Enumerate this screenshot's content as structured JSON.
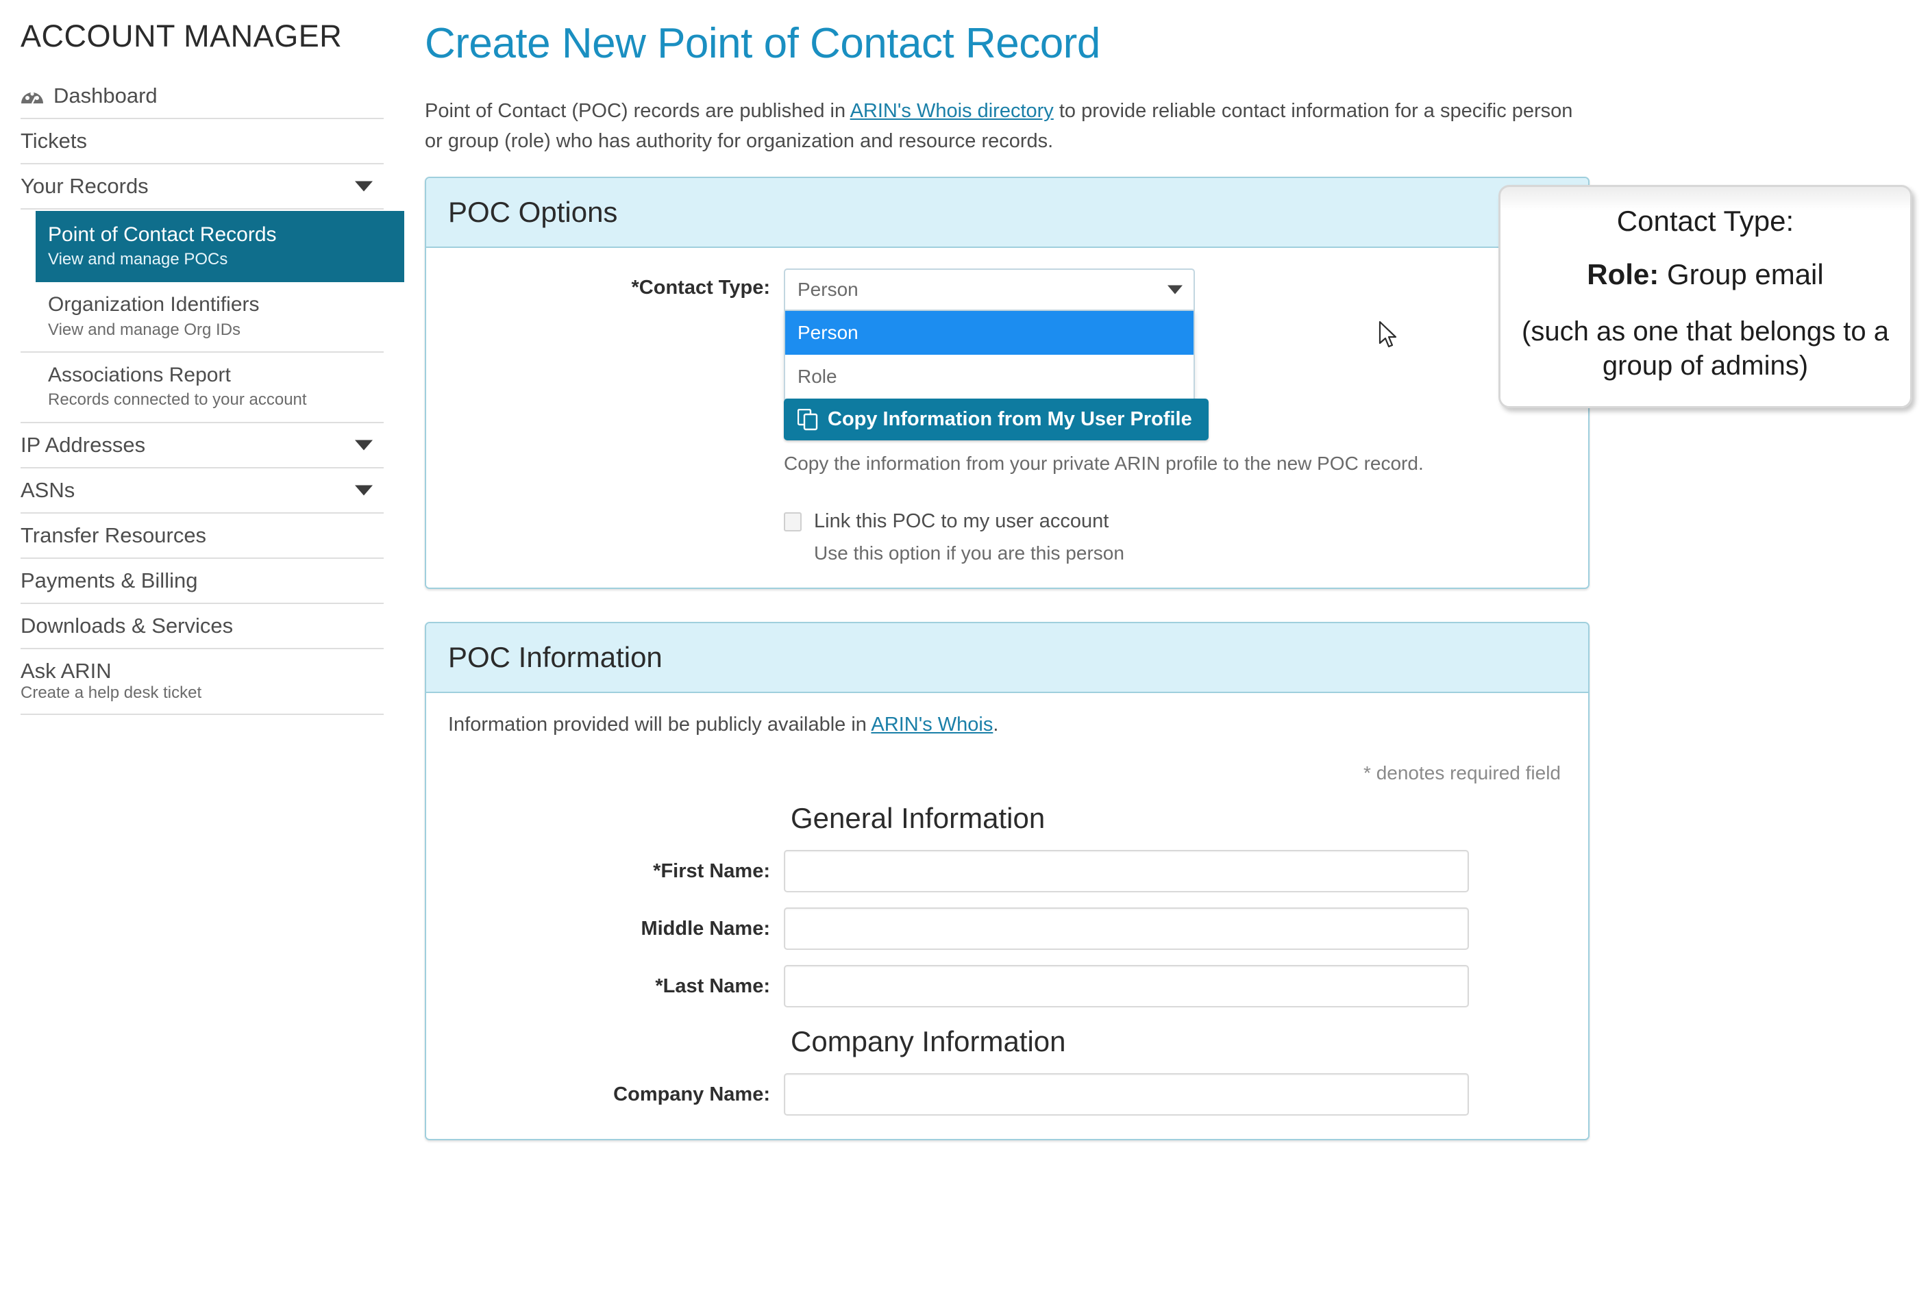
{
  "sidebar": {
    "title": "ACCOUNT MANAGER",
    "dashboard": {
      "label": "Dashboard",
      "icon": "dashboard-gauge-icon"
    },
    "items": [
      {
        "label": "Tickets"
      },
      {
        "label": "Your Records",
        "expandable": true
      }
    ],
    "your_records_children": [
      {
        "title": "Point of Contact Records",
        "desc": "View and manage POCs",
        "active": true
      },
      {
        "title": "Organization Identifiers",
        "desc": "View and manage Org IDs",
        "active": false
      },
      {
        "title": "Associations Report",
        "desc": "Records connected to your account",
        "active": false
      }
    ],
    "items_after": [
      {
        "label": "IP Addresses",
        "expandable": true
      },
      {
        "label": "ASNs",
        "expandable": true
      },
      {
        "label": "Transfer Resources",
        "expandable": false
      },
      {
        "label": "Payments & Billing",
        "expandable": false
      },
      {
        "label": "Downloads & Services",
        "expandable": false
      }
    ],
    "ask_arin": {
      "label": "Ask ARIN",
      "desc": "Create a help desk ticket"
    }
  },
  "main": {
    "page_title": "Create New Point of Contact Record",
    "intro": {
      "before_link": "Point of Contact (POC) records are published in ",
      "link": "ARIN's Whois directory",
      "after_link": " to provide reliable contact information for a specific person or group (role) who has authority for organization and resource records."
    },
    "poc_options": {
      "header": "POC Options",
      "contact_type_label": "*Contact Type:",
      "contact_type_value": "Person",
      "options": [
        "Person",
        "Role"
      ],
      "selected_option": "Person",
      "copy_button": "Copy Information from My User Profile",
      "copy_icon": "copy-icon",
      "copy_helper": "Copy the information from your private ARIN profile to the new POC record.",
      "link_checkbox_label": "Link this POC to my user account",
      "link_checkbox_sub": "Use this option if you are this person",
      "link_checkbox_checked": false
    },
    "poc_information": {
      "header": "POC Information",
      "note_before_link": "Information provided will be publicly available in ",
      "note_link": "ARIN's Whois",
      "note_after_link": ".",
      "required_note": "* denotes required field",
      "general_section_title": "General Information",
      "general_fields": [
        {
          "label": "*First Name:",
          "value": ""
        },
        {
          "label": "Middle Name:",
          "value": ""
        },
        {
          "label": "*Last Name:",
          "value": ""
        }
      ],
      "company_section_title": "Company Information",
      "company_fields": [
        {
          "label": "Company Name:",
          "value": ""
        }
      ]
    }
  },
  "callout": {
    "line1": "Contact Type:",
    "line2_bold": "Role:",
    "line2_rest": " Group email",
    "line3": "(such as one that belongs to a group of admins)"
  },
  "colors": {
    "accent_title": "#1a8fc1",
    "panel_header_bg": "#d9f1f9",
    "panel_border": "#9fcfdd",
    "sidebar_active_bg": "#0f6e8c",
    "dropdown_selected_bg": "#1c8df0",
    "button_bg": "#0e7ba0",
    "link": "#1a7fa8"
  }
}
